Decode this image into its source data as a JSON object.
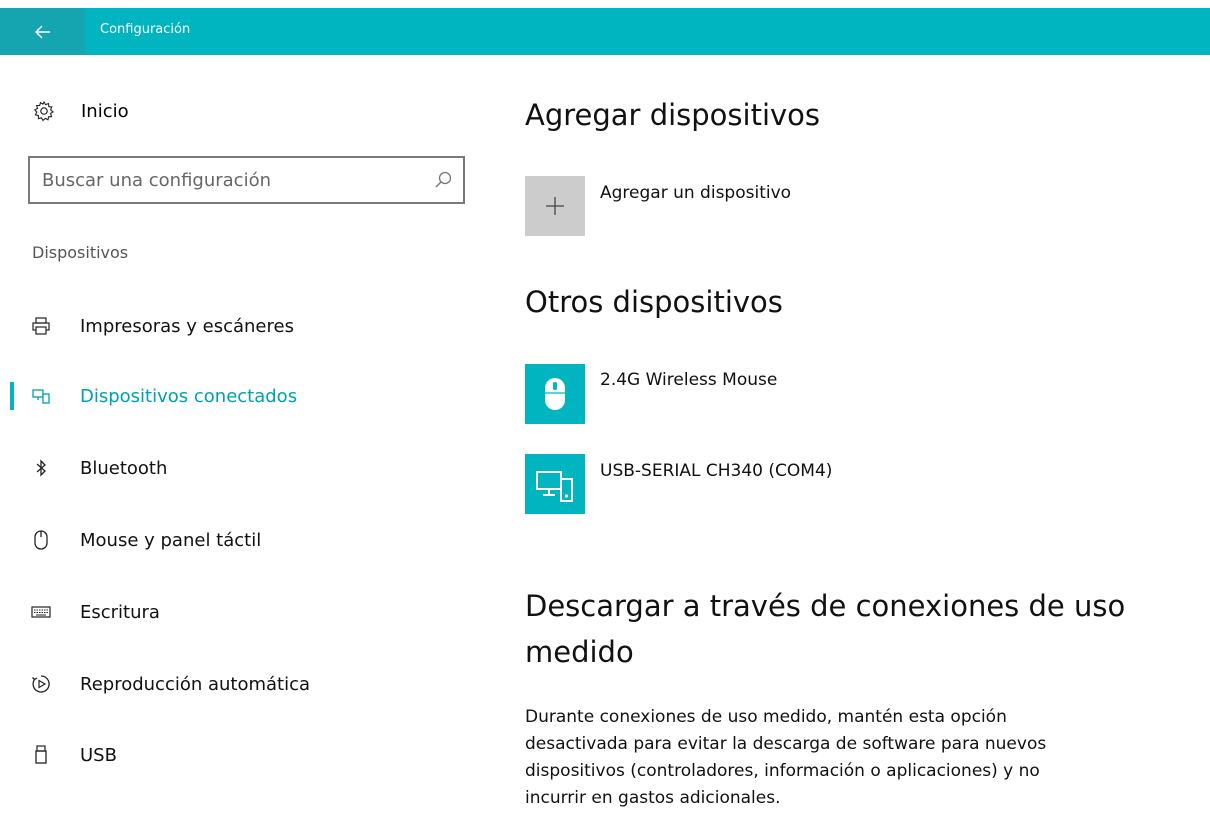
{
  "window": {
    "title": "Configuración"
  },
  "sidebar": {
    "home_label": "Inicio",
    "search_placeholder": "Buscar una configuración",
    "section_label": "Dispositivos",
    "items": [
      {
        "label": "Impresoras y escáneres",
        "icon": "printer-icon",
        "active": false
      },
      {
        "label": "Dispositivos conectados",
        "icon": "connected-devices-icon",
        "active": true
      },
      {
        "label": "Bluetooth",
        "icon": "bluetooth-icon",
        "active": false
      },
      {
        "label": "Mouse y panel táctil",
        "icon": "mouse-icon",
        "active": false
      },
      {
        "label": "Escritura",
        "icon": "keyboard-icon",
        "active": false
      },
      {
        "label": "Reproducción automática",
        "icon": "autoplay-icon",
        "active": false
      },
      {
        "label": "USB",
        "icon": "usb-icon",
        "active": false
      }
    ]
  },
  "main": {
    "add_heading": "Agregar dispositivos",
    "add_device_label": "Agregar un dispositivo",
    "other_heading": "Otros dispositivos",
    "devices": [
      {
        "name": "2.4G Wireless Mouse",
        "icon": "mouse-device-icon"
      },
      {
        "name": "USB-SERIAL CH340 (COM4)",
        "icon": "computer-device-icon"
      }
    ],
    "metered_heading_line1": "Descargar a través de conexiones de uso",
    "metered_heading_line2": "medido",
    "metered_description": "Durante conexiones de uso medido, mantén esta opción desactivada para evitar la descarga de software para nuevos dispositivos (controladores, información o aplicaciones) y no incurrir en gastos adicionales."
  },
  "colors": {
    "accent": "#00b4c0",
    "accent_dark": "#14a5b0",
    "active_text": "#00a0ad",
    "add_tile": "#cccccc"
  }
}
